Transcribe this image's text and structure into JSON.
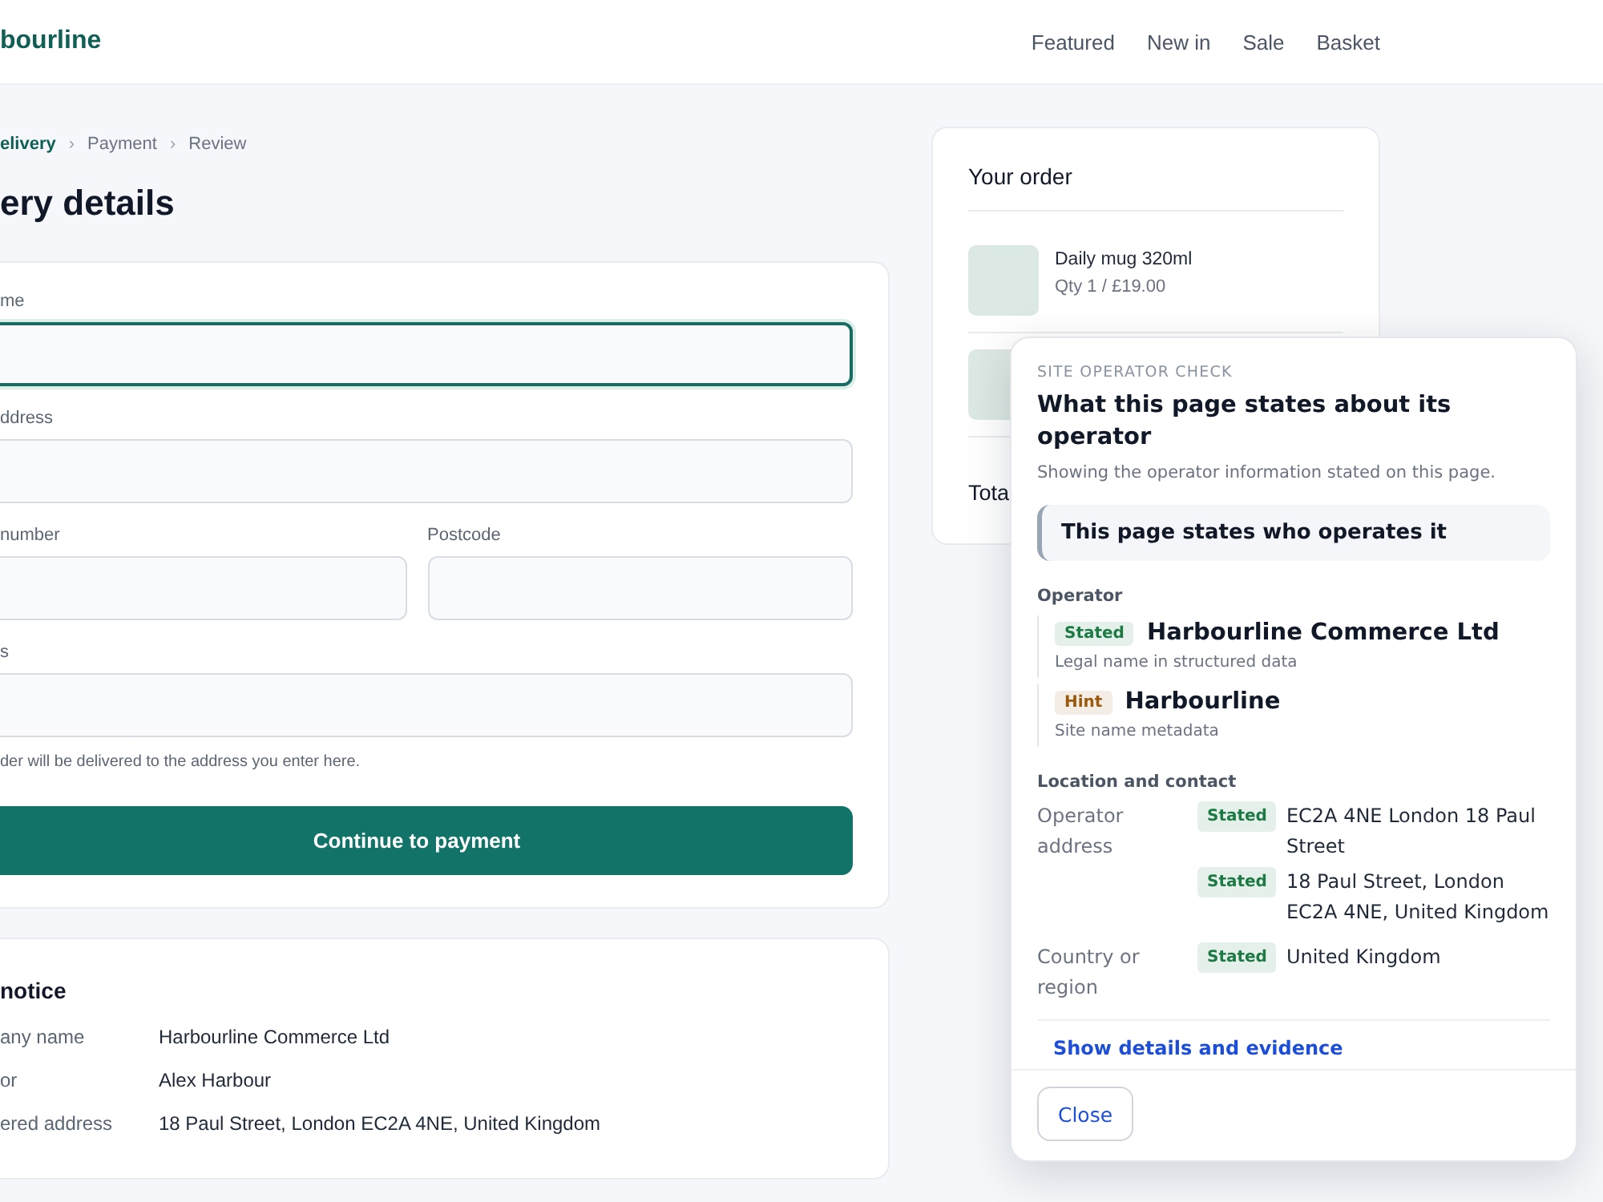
{
  "header": {
    "brand": "bourline",
    "nav": [
      {
        "label": "Featured"
      },
      {
        "label": "New in"
      },
      {
        "label": "Sale"
      },
      {
        "label": "Basket"
      }
    ]
  },
  "breadcrumb": {
    "separator": "›",
    "steps": [
      {
        "label": "elivery",
        "current": true
      },
      {
        "label": "Payment",
        "current": false
      },
      {
        "label": "Review",
        "current": false
      }
    ]
  },
  "page_title": "ery details",
  "form": {
    "rows": [
      {
        "fields": [
          {
            "label": "me",
            "focused": true
          }
        ]
      },
      {
        "fields": [
          {
            "label": "ddress",
            "focused": false
          }
        ]
      },
      {
        "fields": [
          {
            "label": "number",
            "focused": false
          },
          {
            "label": "Postcode",
            "focused": false
          }
        ]
      },
      {
        "fields": [
          {
            "label": "s",
            "focused": false
          }
        ]
      }
    ],
    "hint": "der will be delivered to the address you enter here.",
    "submit": "Continue to payment"
  },
  "notice": {
    "title": "notice",
    "rows": [
      {
        "label": "any name",
        "value": "Harbourline Commerce Ltd"
      },
      {
        "label": "or",
        "value": "Alex Harbour"
      },
      {
        "label": "ered address",
        "value": "18 Paul Street, London EC2A 4NE, United Kingdom"
      }
    ]
  },
  "order": {
    "title": "Your order",
    "items": [
      {
        "kind": "full",
        "name": "Daily mug 320ml",
        "detail": "Qty 1 / £19.00"
      },
      {
        "kind": "covered"
      }
    ],
    "total_label": "Tota"
  },
  "operator_check": {
    "eyebrow": "SITE OPERATOR CHECK",
    "title": "What this page states about its operator",
    "subtitle": "Showing the operator information stated on this page.",
    "callout": "This page states who operates it",
    "operator_heading": "Operator",
    "operators": [
      {
        "badge": "Stated",
        "color": "#1e7a45",
        "name": "Harbourline Commerce Ltd",
        "note": "Legal name in structured data"
      },
      {
        "badge": "Hint",
        "color": "#9a5b0f",
        "name": "Harbourline",
        "note": "Site name metadata"
      }
    ],
    "location_heading": "Location and contact",
    "location_rows": [
      {
        "label": "Operator address",
        "values": [
          {
            "badge": "Stated",
            "color": "#1e7a45",
            "text": "EC2A 4NE London 18 Paul Street"
          },
          {
            "badge": "Stated",
            "color": "#1e7a45",
            "text": "18 Paul Street, London EC2A 4NE, United Kingdom"
          }
        ]
      },
      {
        "label": "Country or region",
        "values": [
          {
            "badge": "Stated",
            "color": "#1e7a45",
            "text": "United Kingdom"
          }
        ]
      }
    ],
    "link": "Show details and evidence",
    "close": "Close"
  }
}
